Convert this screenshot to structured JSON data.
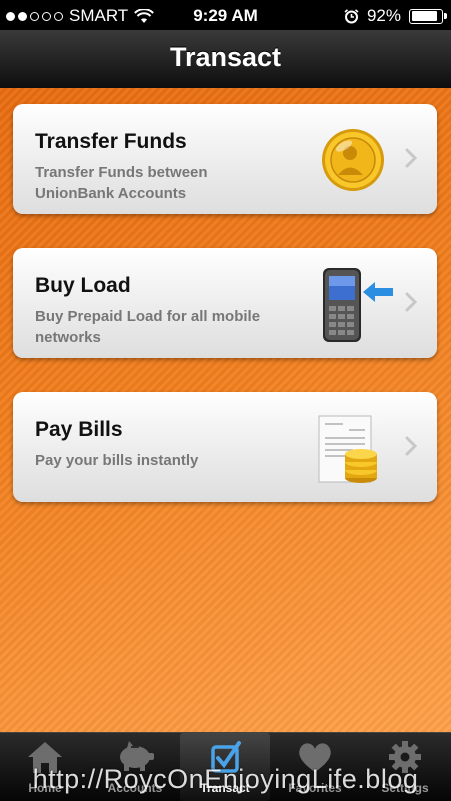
{
  "status_bar": {
    "carrier": "SMART",
    "signal_bars_filled": 2,
    "signal_bars_total": 5,
    "time": "9:29 AM",
    "battery": "92%",
    "battery_level": 0.92
  },
  "nav": {
    "title": "Transact"
  },
  "cards": [
    {
      "title": "Transfer Funds",
      "description": "Transfer Funds between UnionBank Accounts",
      "icon": "gold-coin-icon"
    },
    {
      "title": "Buy Load",
      "description": "Buy Prepaid Load for all mobile networks",
      "icon": "mobile-phone-icon"
    },
    {
      "title": "Pay Bills",
      "description": "Pay your bills instantly",
      "icon": "bill-and-coins-icon"
    }
  ],
  "tabs": [
    {
      "label": "Home",
      "icon": "house-icon"
    },
    {
      "label": "Accounts",
      "icon": "piggy-bank-icon"
    },
    {
      "label": "Transact",
      "icon": "checkbox-icon",
      "active": true
    },
    {
      "label": "Favorites",
      "icon": "heart-icon"
    },
    {
      "label": "Settings",
      "icon": "gear-icon"
    }
  ],
  "watermark": "http://RoycOnEnjoyingLife.blog",
  "colors": {
    "accent_orange": "#f27f1e",
    "tab_active": "#4aa3e8"
  }
}
